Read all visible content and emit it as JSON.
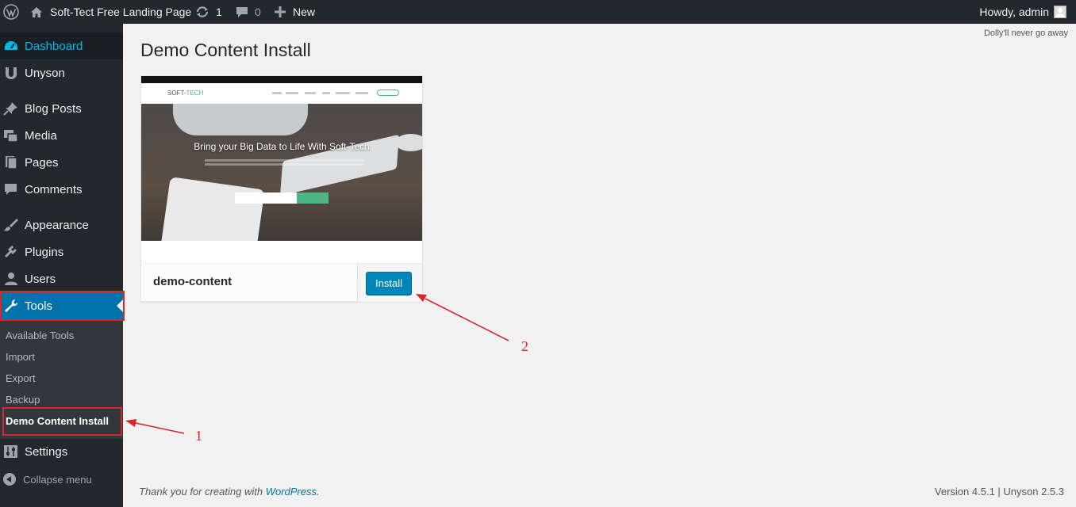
{
  "admin_bar": {
    "site_name": "Soft-Tect Free Landing Page",
    "updates_count": "1",
    "comments_count": "0",
    "new_label": "New",
    "greeting": "Howdy, admin"
  },
  "sidebar": {
    "items": [
      {
        "label": "Dashboard",
        "icon": "dashboard-icon"
      },
      {
        "label": "Unyson",
        "icon": "unyson-icon"
      },
      {
        "label": "Blog Posts",
        "icon": "pin-icon"
      },
      {
        "label": "Media",
        "icon": "media-icon"
      },
      {
        "label": "Pages",
        "icon": "pages-icon"
      },
      {
        "label": "Comments",
        "icon": "comment-icon"
      },
      {
        "label": "Appearance",
        "icon": "brush-icon"
      },
      {
        "label": "Plugins",
        "icon": "plugin-icon"
      },
      {
        "label": "Users",
        "icon": "user-icon"
      },
      {
        "label": "Tools",
        "icon": "wrench-icon"
      },
      {
        "label": "Settings",
        "icon": "settings-icon"
      }
    ],
    "submenu": [
      "Available Tools",
      "Import",
      "Export",
      "Backup",
      "Demo Content Install"
    ],
    "collapse_label": "Collapse menu"
  },
  "dolly": "Dolly'll never go away",
  "page_title": "Demo Content Install",
  "theme_card": {
    "name": "demo-content",
    "install_label": "Install",
    "screenshot": {
      "logo_prefix": "SOFT-",
      "logo_accent": "TECH",
      "headline": "Bring your Big Data to Life With Soft-Tech"
    }
  },
  "annotations": {
    "step1": "1",
    "step2": "2"
  },
  "footer": {
    "thanks_prefix": "Thank you for creating with ",
    "wordpress_link": "WordPress",
    "thanks_suffix": ".",
    "version": "Version 4.5.1 | Unyson 2.5.3"
  },
  "colors": {
    "adminbar_bg": "#23282d",
    "active_menu": "#0073aa",
    "button": "#0085ba",
    "annotation_red": "#d8262c"
  }
}
